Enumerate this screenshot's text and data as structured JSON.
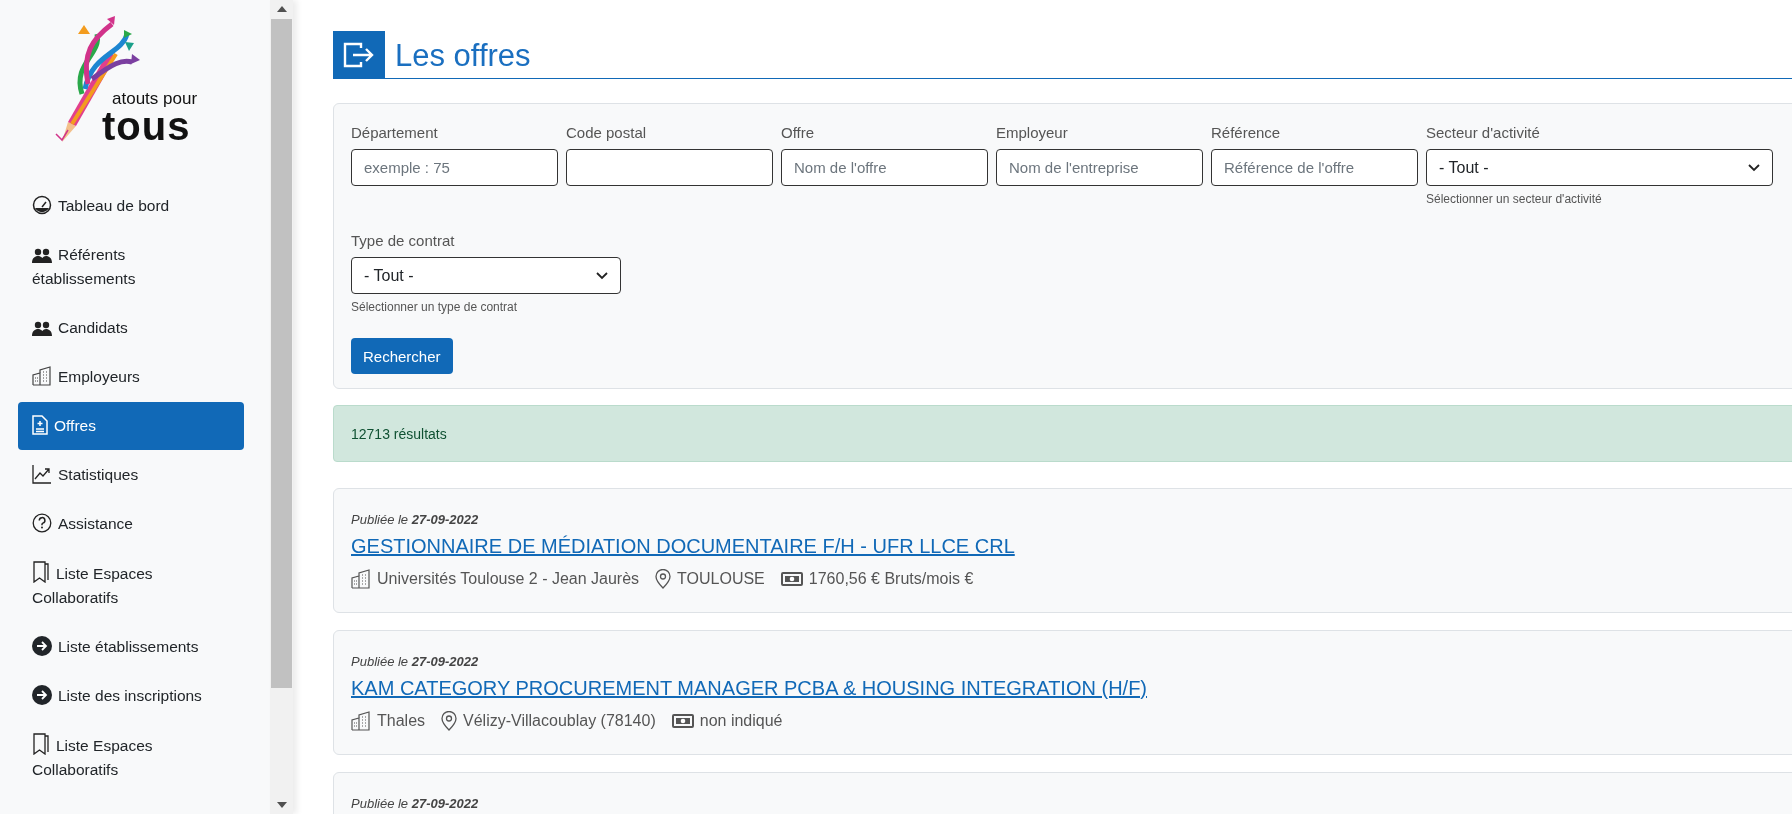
{
  "logo": {
    "line_1": "atouts pour",
    "line_2": "tous"
  },
  "sidebar": {
    "items": [
      {
        "label": "Tableau de bord",
        "kind": "dashboard",
        "selected": false
      },
      {
        "label": "Référents établissements",
        "kind": "people",
        "selected": false
      },
      {
        "label": "Candidats",
        "kind": "people",
        "selected": false
      },
      {
        "label": "Employeurs",
        "kind": "building",
        "selected": false
      },
      {
        "label": "Offres",
        "kind": "document",
        "selected": true
      },
      {
        "label": "Statistiques",
        "kind": "chart",
        "selected": false
      },
      {
        "label": "Assistance",
        "kind": "help",
        "selected": false
      },
      {
        "label": "Liste Espaces Collaboratifs",
        "kind": "bookmark",
        "selected": false
      },
      {
        "label": "Liste établissements",
        "kind": "arrow",
        "selected": false
      },
      {
        "label": "Liste des inscriptions",
        "kind": "arrow",
        "selected": false
      },
      {
        "label": "Liste Espaces Collaboratifs",
        "kind": "bookmark",
        "selected": false
      }
    ]
  },
  "page": {
    "title": "Les offres"
  },
  "filters": {
    "fields": [
      {
        "label": "Département",
        "kind": "text",
        "placeholder": "exemple : 75"
      },
      {
        "label": "Code postal",
        "kind": "text"
      },
      {
        "label": "Offre",
        "kind": "text",
        "placeholder": "Nom de l'offre"
      },
      {
        "label": "Employeur",
        "kind": "text",
        "placeholder": "Nom de l'entreprise"
      },
      {
        "label": "Référence",
        "kind": "text",
        "placeholder": "Référence de l'offre"
      },
      {
        "label": "Secteur d'activité",
        "kind": "select",
        "value": "- Tout -",
        "hint": "Sélectionner un secteur d'activité"
      },
      {
        "label": "Type de contrat",
        "kind": "select",
        "value": "- Tout -",
        "hint": "Sélectionner un type de contrat"
      }
    ],
    "button": "Rechercher"
  },
  "results": {
    "count": "12713 résultats"
  },
  "offers": [
    {
      "published": "Publiée le **27-09-2022**",
      "title": "GESTIONNAIRE DE MÉDIATION DOCUMENTAIRE F/H - UFR LLCE CRL",
      "employer": "Universités Toulouse 2 - Jean Jaurès",
      "location": "TOULOUSE",
      "salary": "1760,56 € Bruts/mois €"
    },
    {
      "published": "Publiée le **27-09-2022**",
      "title": "KAM CATEGORY PROCUREMENT MANAGER PCBA & HOUSING INTEGRATION (H/F)",
      "employer": "Thales",
      "location": "Vélizy-Villacoublay (78140)",
      "salary": "non indiqué"
    },
    {
      "published": "Publiée le **27-09-2022**"
    }
  ]
}
